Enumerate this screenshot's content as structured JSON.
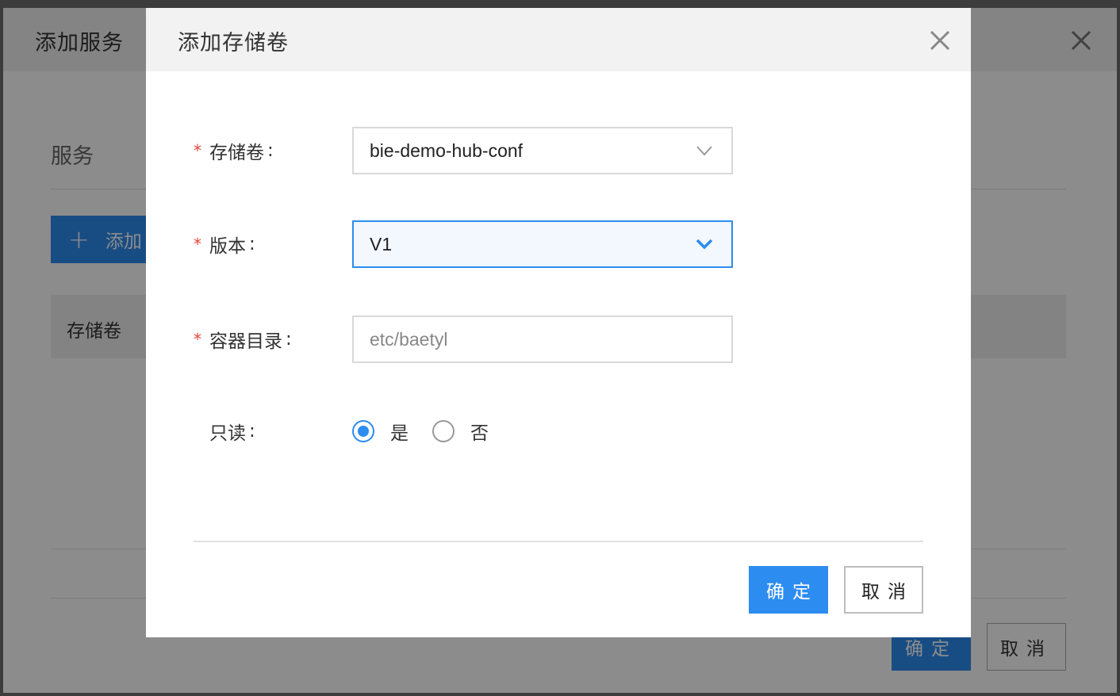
{
  "background_dialog": {
    "title": "添加服务",
    "section_title": "服务",
    "add_button_label": "添加",
    "table_header": "存储卷",
    "ok_label": "确定",
    "cancel_label": "取消"
  },
  "modal": {
    "title": "添加存储卷",
    "fields": {
      "volume": {
        "label": "存储卷",
        "value": "bie-demo-hub-conf",
        "required": true
      },
      "version": {
        "label": "版本",
        "value": "V1",
        "required": true
      },
      "container_dir": {
        "label": "容器目录",
        "placeholder": "etc/baetyl",
        "required": true
      },
      "readonly": {
        "label": "只读",
        "options": [
          "是",
          "否"
        ],
        "selected": "是"
      }
    },
    "colon": ":",
    "required_mark": "*",
    "ok_label": "确定",
    "cancel_label": "取消"
  },
  "colors": {
    "primary": "#2d8cf0",
    "required": "#e8443a",
    "overlay": "rgba(0,0,0,0.45)"
  }
}
